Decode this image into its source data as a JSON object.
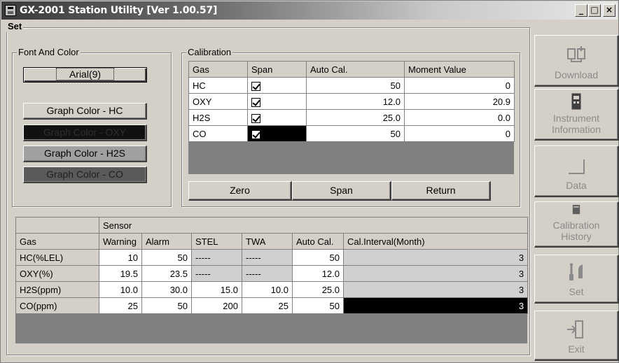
{
  "window": {
    "title": "GX-2001 Station Utility [Ver 1.00.57]",
    "controls": {
      "minimize": "_",
      "maximize": "□",
      "close": "×"
    }
  },
  "set_group": {
    "label": "Set",
    "font_color": {
      "label": "Font And Color",
      "font_button": "Arial(9)",
      "graph_buttons": [
        {
          "label": "Graph Color - HC"
        },
        {
          "label": "Graph Color - OXY"
        },
        {
          "label": "Graph Color - H2S"
        },
        {
          "label": "Graph Color - CO"
        }
      ]
    },
    "calibration": {
      "label": "Calibration",
      "headers": [
        "Gas",
        "Span",
        "Auto Cal.",
        "Moment Value"
      ],
      "rows": [
        {
          "gas": "HC",
          "span": true,
          "auto_cal": "50",
          "moment": "0"
        },
        {
          "gas": "OXY",
          "span": true,
          "auto_cal": "12.0",
          "moment": "20.9"
        },
        {
          "gas": "H2S",
          "span": true,
          "auto_cal": "25.0",
          "moment": "0.0"
        },
        {
          "gas": "CO",
          "span": true,
          "auto_cal": "50",
          "moment": "0"
        }
      ],
      "buttons": {
        "zero": "Zero",
        "span": "Span",
        "return": "Return"
      }
    }
  },
  "sensor_table": {
    "group_header": "Sensor",
    "headers": [
      "Gas",
      "Warning",
      "Alarm",
      "STEL",
      "TWA",
      "Auto Cal.",
      "Cal.Interval(Month)"
    ],
    "rows": [
      {
        "gas": "HC(%LEL)",
        "warning": "10",
        "alarm": "50",
        "stel": "-----",
        "twa": "-----",
        "auto_cal": "50",
        "interval": "3"
      },
      {
        "gas": "OXY(%)",
        "warning": "19.5",
        "alarm": "23.5",
        "stel": "-----",
        "twa": "-----",
        "auto_cal": "12.0",
        "interval": "3"
      },
      {
        "gas": "H2S(ppm)",
        "warning": "10.0",
        "alarm": "30.0",
        "stel": "15.0",
        "twa": "10.0",
        "auto_cal": "25.0",
        "interval": "3"
      },
      {
        "gas": "CO(ppm)",
        "warning": "25",
        "alarm": "50",
        "stel": "200",
        "twa": "25",
        "auto_cal": "50",
        "interval": "3"
      }
    ]
  },
  "sidebar": {
    "download": "Download",
    "instrument_information": "Instrument Information",
    "data": "Data",
    "calibration_history": "Calibration History",
    "set": "Set",
    "exit": "Exit"
  },
  "colors": {
    "face": "#d4d0c8",
    "disabled_text": "#8a8a8a",
    "selected_cell": "#000000"
  }
}
